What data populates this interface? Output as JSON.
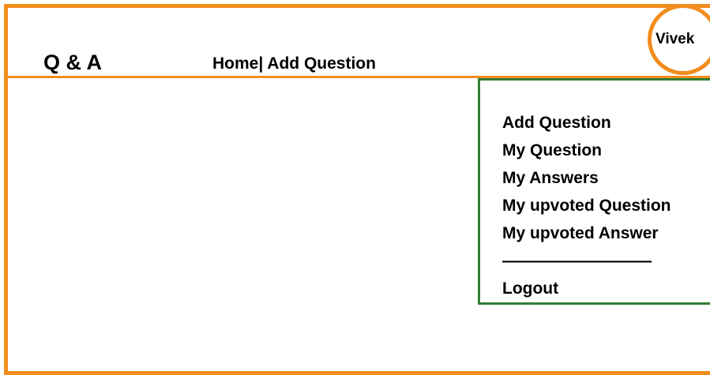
{
  "header": {
    "brand": "Q & A",
    "nav": {
      "home_label": "Home|",
      "add_question_label": " Add Question"
    },
    "user": {
      "name": "Vivek"
    }
  },
  "dropdown": {
    "items": [
      {
        "label": "Add Question"
      },
      {
        "label": "My Question"
      },
      {
        "label": "My Answers"
      },
      {
        "label": "My upvoted Question"
      },
      {
        "label": "My upvoted Answer"
      }
    ],
    "separator": "—————————",
    "logout_label": "Logout"
  },
  "colors": {
    "frame": "#f28c1e",
    "dropdown_border": "#2f7d32"
  }
}
